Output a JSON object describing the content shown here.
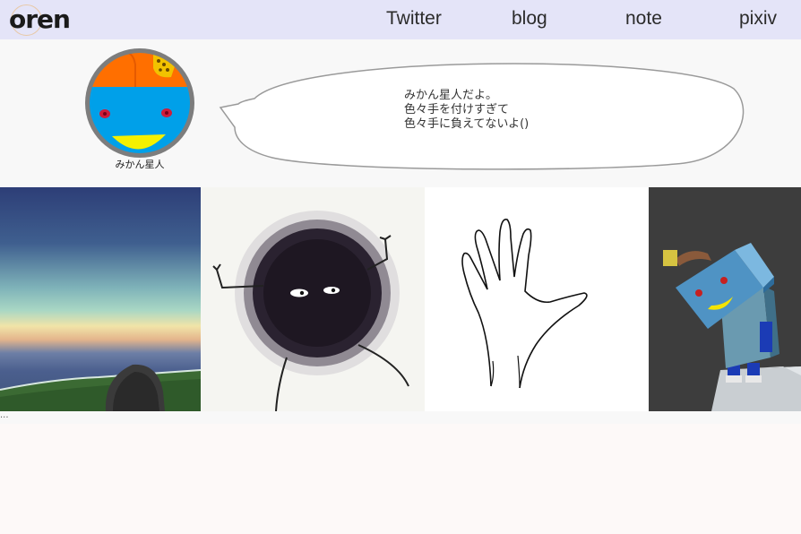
{
  "header": {
    "logo_text": "oren",
    "nav": [
      {
        "label": "Twitter"
      },
      {
        "label": "blog"
      },
      {
        "label": "note"
      },
      {
        "label": "pixiv"
      }
    ]
  },
  "profile": {
    "name": "みかん星人",
    "bubble_lines": [
      "みかん星人だよ。",
      "色々手を付けすぎて",
      "色々手に負えてないよ()"
    ]
  },
  "gallery": {
    "items": [
      {
        "icon": "landscape-painting"
      },
      {
        "icon": "fuzzy-creature-drawing"
      },
      {
        "icon": "hand-sketch"
      },
      {
        "icon": "3d-robot-render"
      }
    ],
    "more": "..."
  },
  "colors": {
    "header_bg": "#e4e4f8",
    "avatar_orange": "#ff6f00",
    "avatar_blue": "#00a0e9",
    "avatar_yellow": "#f5f000"
  }
}
